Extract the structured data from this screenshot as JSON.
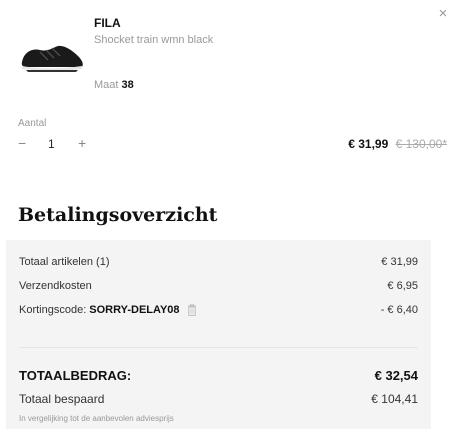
{
  "item": {
    "brand": "FILA",
    "name": "Shocket train wmn black",
    "size_label": "Maat",
    "size_value": "38",
    "quantity_label": "Aantal",
    "quantity_value": "1",
    "minus_symbol": "−",
    "plus_symbol": "+",
    "price_current": "€ 31,99",
    "price_original": "€ 130,00*",
    "close_symbol": "×"
  },
  "summary": {
    "title": "Betalingsoverzicht",
    "rows": [
      {
        "label": "Totaal artikelen (1)",
        "value": "€ 31,99"
      },
      {
        "label": "Verzendkosten",
        "value": "€ 6,95"
      }
    ],
    "discount": {
      "label": "Kortingscode:",
      "code": "SORRY-DELAY08",
      "value": "- € 6,40"
    },
    "total": {
      "label": "TOTAALBEDRAG:",
      "value": "€ 32,54"
    },
    "saved": {
      "label": "Totaal bespaard",
      "value": "€ 104,41"
    },
    "note": "In vergelijking tot de aanbevolen adviesprijs"
  },
  "colors": {
    "summary_bg": "#f4f4f4",
    "text_dark": "#111111",
    "text_muted": "#999999"
  },
  "icons": {
    "close": "close-icon",
    "delete": "trash-icon",
    "decrease": "minus-icon",
    "increase": "plus-icon"
  }
}
